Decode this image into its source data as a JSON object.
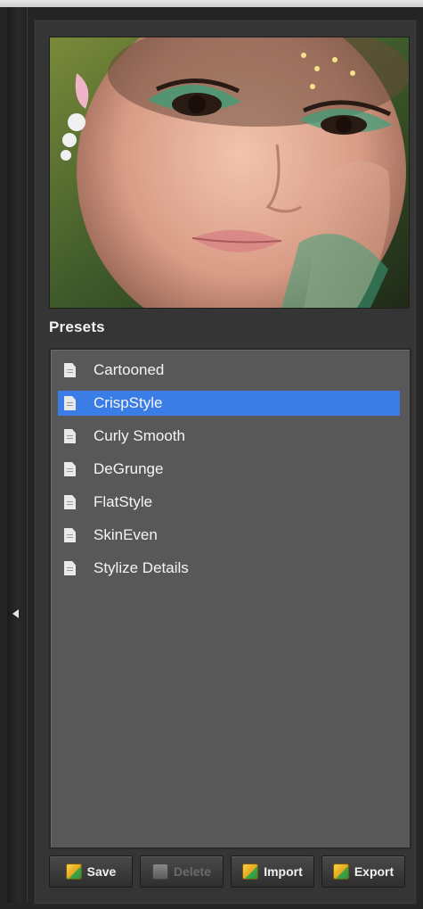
{
  "panel": {
    "section_title": "Presets",
    "presets": [
      {
        "label": "Cartooned",
        "selected": false
      },
      {
        "label": "CrispStyle",
        "selected": true
      },
      {
        "label": "Curly Smooth",
        "selected": false
      },
      {
        "label": "DeGrunge",
        "selected": false
      },
      {
        "label": "FlatStyle",
        "selected": false
      },
      {
        "label": "SkinEven",
        "selected": false
      },
      {
        "label": "Stylize Details",
        "selected": false
      }
    ],
    "buttons": {
      "save": "Save",
      "delete": "Delete",
      "import": "Import",
      "export": "Export"
    }
  },
  "icons": {
    "collapse": "chevron-left-icon",
    "preset": "document-icon",
    "button": "preset-box-icon"
  },
  "colors": {
    "selection": "#3b7de6",
    "list_bg": "#585858",
    "panel_bg": "#353535"
  }
}
